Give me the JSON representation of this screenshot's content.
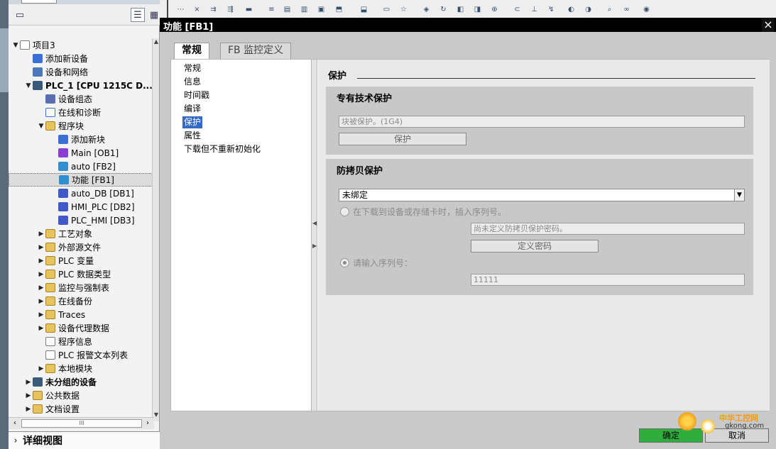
{
  "project_tree": {
    "items": [
      {
        "label": "项目3",
        "expand": "▼",
        "icon": "project-doc-icon",
        "bold": false
      },
      {
        "label": "添加新设备",
        "expand": "",
        "icon": "add-device-icon",
        "bold": false
      },
      {
        "label": "设备和网络",
        "expand": "",
        "icon": "network-icon",
        "bold": false
      },
      {
        "label": "PLC_1 [CPU 1215C D...",
        "expand": "▼",
        "icon": "plc-icon",
        "bold": true
      },
      {
        "label": "设备组态",
        "expand": "",
        "icon": "device-config-icon",
        "bold": false
      },
      {
        "label": "在线和诊断",
        "expand": "",
        "icon": "diagnostics-icon",
        "bold": false
      },
      {
        "label": "程序块",
        "expand": "▼",
        "icon": "folder-icon",
        "bold": false
      },
      {
        "label": "添加新块",
        "expand": "",
        "icon": "add-block-icon",
        "bold": false
      },
      {
        "label": "Main [OB1]",
        "expand": "",
        "icon": "ob-block-icon",
        "bold": false
      },
      {
        "label": "auto [FB2]",
        "expand": "",
        "icon": "fb-block-icon",
        "bold": false
      },
      {
        "label": "功能 [FB1]",
        "expand": "",
        "icon": "fb-block-icon",
        "bold": false
      },
      {
        "label": "auto_DB [DB1]",
        "expand": "",
        "icon": "db-block-icon",
        "bold": false
      },
      {
        "label": "HMI_PLC [DB2]",
        "expand": "",
        "icon": "db-block-icon",
        "bold": false
      },
      {
        "label": "PLC_HMI [DB3]",
        "expand": "",
        "icon": "db-block-icon",
        "bold": false
      },
      {
        "label": "工艺对象",
        "expand": "▶",
        "icon": "folder-icon",
        "bold": false
      },
      {
        "label": "外部源文件",
        "expand": "▶",
        "icon": "folder-icon",
        "bold": false
      },
      {
        "label": "PLC 变量",
        "expand": "▶",
        "icon": "folder-icon",
        "bold": false
      },
      {
        "label": "PLC 数据类型",
        "expand": "▶",
        "icon": "folder-icon",
        "bold": false
      },
      {
        "label": "监控与强制表",
        "expand": "▶",
        "icon": "folder-icon",
        "bold": false
      },
      {
        "label": "在线备份",
        "expand": "▶",
        "icon": "folder-icon",
        "bold": false
      },
      {
        "label": "Traces",
        "expand": "▶",
        "icon": "folder-icon",
        "bold": false
      },
      {
        "label": "设备代理数据",
        "expand": "▶",
        "icon": "folder-icon",
        "bold": false
      },
      {
        "label": "程序信息",
        "expand": "",
        "icon": "program-info-icon",
        "bold": false
      },
      {
        "label": "PLC 报警文本列表",
        "expand": "",
        "icon": "alarm-text-icon",
        "bold": false
      },
      {
        "label": "本地模块",
        "expand": "▶",
        "icon": "folder-icon",
        "bold": false
      },
      {
        "label": "未分组的设备",
        "expand": "▶",
        "icon": "devices-icon",
        "bold": true
      },
      {
        "label": "公共数据",
        "expand": "▶",
        "icon": "folder-icon",
        "bold": false
      },
      {
        "label": "文档设置",
        "expand": "▶",
        "icon": "folder-icon",
        "bold": false
      }
    ],
    "selected_index": 10,
    "hscroll_grip": "III"
  },
  "detail_view": {
    "chevron": "›",
    "label": "详细视图"
  },
  "dialog": {
    "title": "功能 [FB1]",
    "close": "×",
    "tabs": [
      {
        "label": "常规",
        "active": true
      },
      {
        "label": "FB 监控定义",
        "active": false
      }
    ],
    "nav": [
      "常规",
      "信息",
      "时间戳",
      "编译",
      "保护",
      "属性",
      "下载但不重新初始化"
    ],
    "nav_selected": 4,
    "section_title": "保护",
    "know_how": {
      "title": "专有技术保护",
      "status_field": "块被保护。(1G4)",
      "button": "保护"
    },
    "copy_protection": {
      "title": "防拷贝保护",
      "dropdown_value": "未绑定",
      "radio1_label": "在下载到设备或存储卡时，插入序列号。",
      "radio1_checked": false,
      "password_field": "尚未定义防拷贝保护密码。",
      "define_password_button": "定义密码",
      "radio2_label": "请输入序列号：",
      "radio2_checked": true,
      "serial_field": "11111"
    },
    "ok_button": "确定",
    "cancel_button": "取消"
  },
  "watermark": {
    "cn": "中华工控网",
    "en": "gkong.com"
  },
  "colors": {
    "selection": "#3569c6",
    "ok_button": "#2fae3e",
    "titlebar": "#000000"
  }
}
